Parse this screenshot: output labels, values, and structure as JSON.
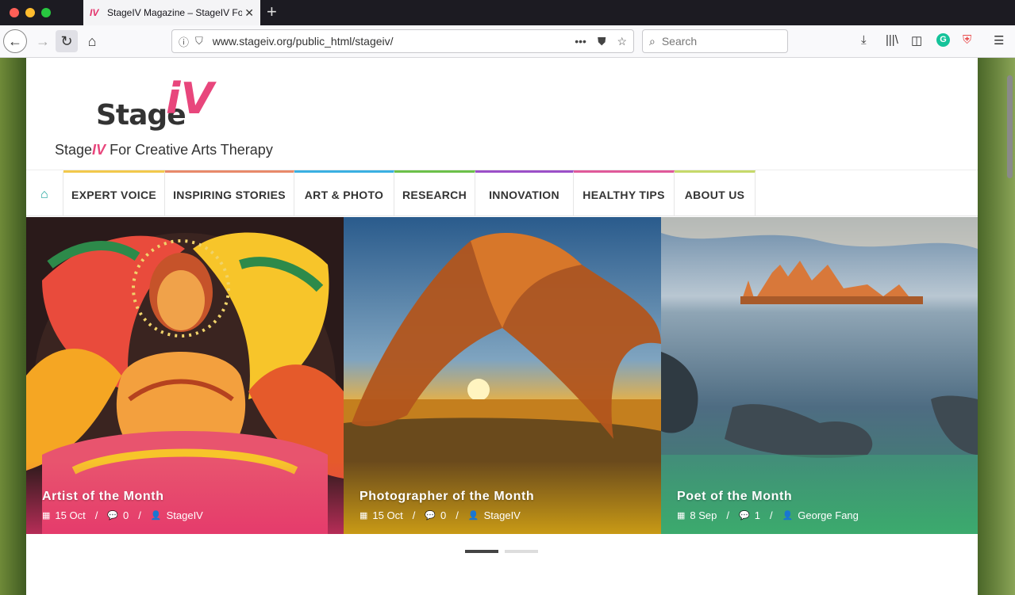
{
  "browser": {
    "tab_title": "StageIV Magazine – StageIV For Creative Arts Therapy",
    "tab_favicon": "IV",
    "url": "www.stageiv.org/public_html/stageiv/",
    "search_placeholder": "Search"
  },
  "site": {
    "logo_word": "Stage",
    "logo_iv": "iV",
    "tagline_before": "Stage",
    "tagline_iv": "IV",
    "tagline_after": "For Creative Arts Therapy",
    "brand_color": "#e8467c"
  },
  "nav": {
    "home_icon": "home-icon",
    "items": [
      {
        "label": "EXPERT VOICE",
        "color": "#f2c94c"
      },
      {
        "label": "INSPIRING STORIES",
        "color": "#e88a6a"
      },
      {
        "label": "ART & PHOTO",
        "color": "#3ab0e2"
      },
      {
        "label": "RESEARCH",
        "color": "#6cc04a"
      },
      {
        "label": "INNOVATION",
        "color": "#9b4fc8"
      },
      {
        "label": "HEALTHY TIPS",
        "color": "#e05a9a"
      },
      {
        "label": "ABOUT US",
        "color": "#c6d96a"
      }
    ],
    "home_color": "#1aa39b"
  },
  "slides": [
    {
      "title": "Artist of the Month",
      "date": "15 Oct",
      "comments": "0",
      "author": "StageIV",
      "overlay": "#e4336b"
    },
    {
      "title": "Photographer of the Month",
      "date": "15 Oct",
      "comments": "0",
      "author": "StageIV",
      "overlay": "#d9a814"
    },
    {
      "title": "Poet of the Month",
      "date": "8 Sep",
      "comments": "1",
      "author": "George Fang",
      "overlay": "#3bb46a"
    }
  ],
  "slider": {
    "active_page": 1,
    "pages": 2
  }
}
